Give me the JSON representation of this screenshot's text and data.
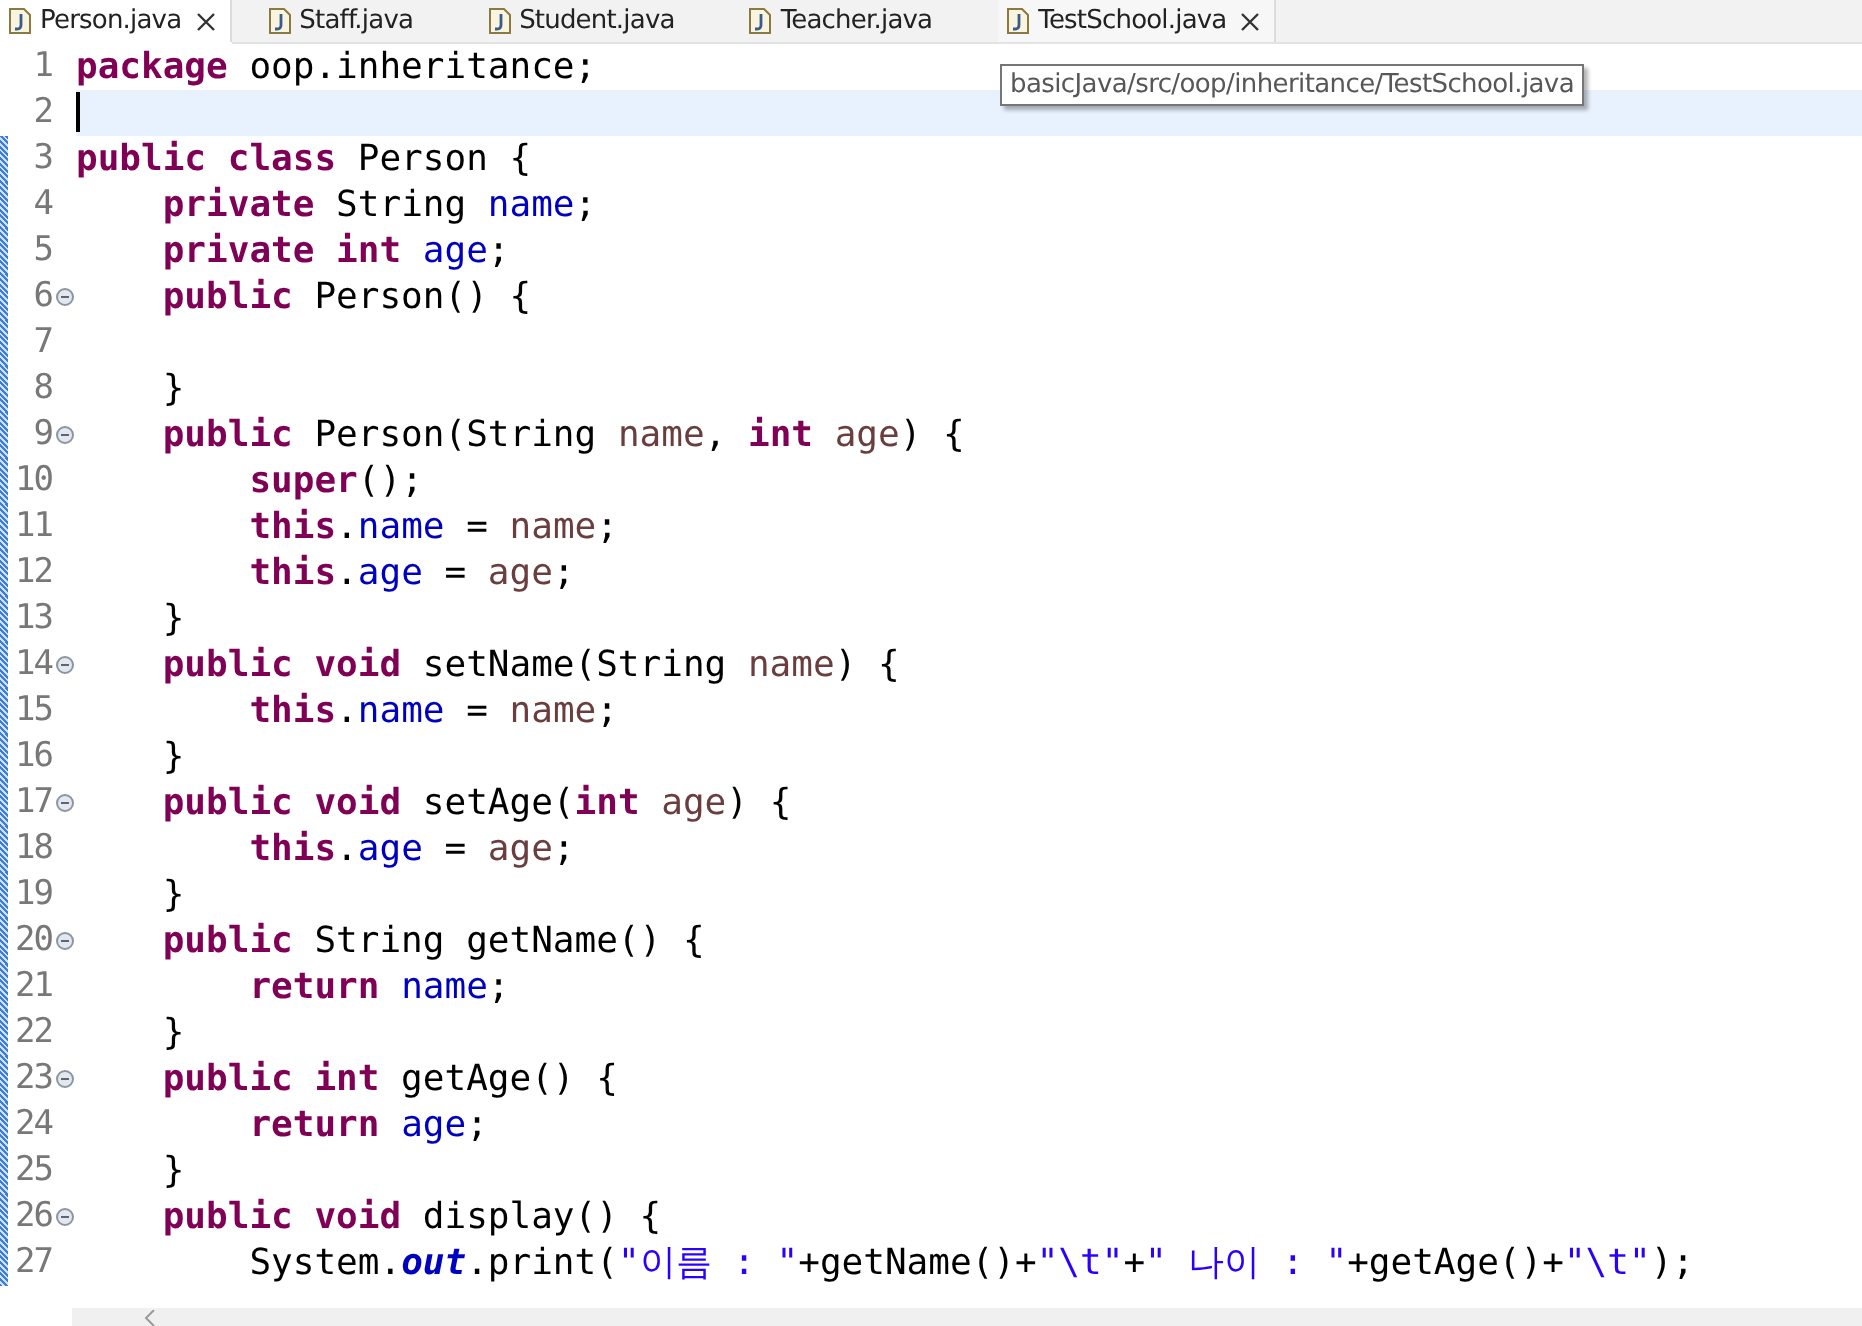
{
  "tabs": [
    {
      "label": "Person.java",
      "selected": true,
      "closable": true
    },
    {
      "label": "Staff.java",
      "selected": false,
      "closable": false
    },
    {
      "label": "Student.java",
      "selected": false,
      "closable": false
    },
    {
      "label": "Teacher.java",
      "selected": false,
      "closable": false
    },
    {
      "label": "TestSchool.java",
      "selected": false,
      "closable": true
    }
  ],
  "tooltip": "basicJava/src/oop/inheritance/TestSchool.java",
  "lines": [
    {
      "number": "1",
      "fold": false,
      "changed": false,
      "current": false,
      "tokens": [
        {
          "kind": "keyword",
          "text": "package"
        },
        {
          "kind": "plain",
          "text": " oop.inheritance;"
        }
      ]
    },
    {
      "number": "2",
      "fold": false,
      "changed": false,
      "current": true
    },
    {
      "number": "3",
      "fold": false,
      "changed": true,
      "current": false,
      "tokens": [
        {
          "kind": "keyword",
          "text": "public class"
        },
        {
          "kind": "plain",
          "text": " Person {"
        }
      ]
    },
    {
      "number": "4",
      "fold": false,
      "changed": true,
      "current": false,
      "tokens": [
        {
          "kind": "keyword",
          "text": "    private"
        },
        {
          "kind": "plain",
          "text": " String "
        },
        {
          "kind": "field",
          "text": "name"
        },
        {
          "kind": "plain",
          "text": ";"
        }
      ]
    },
    {
      "number": "5",
      "fold": false,
      "changed": true,
      "current": false,
      "tokens": [
        {
          "kind": "keyword",
          "text": "    private int "
        },
        {
          "kind": "field",
          "text": "age"
        },
        {
          "kind": "plain",
          "text": ";"
        }
      ]
    },
    {
      "number": "6",
      "fold": true,
      "changed": true,
      "current": false,
      "tokens": [
        {
          "kind": "keyword",
          "text": "    public"
        },
        {
          "kind": "plain",
          "text": " Person() {"
        }
      ]
    },
    {
      "number": "7",
      "fold": false,
      "changed": true,
      "current": false
    },
    {
      "number": "8",
      "fold": false,
      "changed": true,
      "current": false,
      "tokens": [
        {
          "kind": "plain",
          "text": "    }"
        }
      ]
    },
    {
      "number": "9",
      "fold": true,
      "changed": true,
      "current": false,
      "tokens": [
        {
          "kind": "keyword",
          "text": "    public"
        },
        {
          "kind": "plain",
          "text": " Person(String "
        },
        {
          "kind": "param",
          "text": "name"
        },
        {
          "kind": "plain",
          "text": ", "
        },
        {
          "kind": "keyword",
          "text": "int "
        },
        {
          "kind": "param",
          "text": "age"
        },
        {
          "kind": "plain",
          "text": ") {"
        }
      ]
    },
    {
      "number": "10",
      "fold": false,
      "changed": true,
      "current": false,
      "tokens": [
        {
          "kind": "keyword",
          "text": "        super"
        },
        {
          "kind": "plain",
          "text": "();"
        }
      ]
    },
    {
      "number": "11",
      "fold": false,
      "changed": true,
      "current": false,
      "tokens": [
        {
          "kind": "keyword",
          "text": "        this"
        },
        {
          "kind": "plain",
          "text": "."
        },
        {
          "kind": "field",
          "text": "name"
        },
        {
          "kind": "plain",
          "text": " = "
        },
        {
          "kind": "param",
          "text": "name"
        },
        {
          "kind": "plain",
          "text": ";"
        }
      ]
    },
    {
      "number": "12",
      "fold": false,
      "changed": true,
      "current": false,
      "tokens": [
        {
          "kind": "keyword",
          "text": "        this"
        },
        {
          "kind": "plain",
          "text": "."
        },
        {
          "kind": "field",
          "text": "age"
        },
        {
          "kind": "plain",
          "text": " = "
        },
        {
          "kind": "param",
          "text": "age"
        },
        {
          "kind": "plain",
          "text": ";"
        }
      ]
    },
    {
      "number": "13",
      "fold": false,
      "changed": true,
      "current": false,
      "tokens": [
        {
          "kind": "plain",
          "text": "    }"
        }
      ]
    },
    {
      "number": "14",
      "fold": true,
      "changed": true,
      "current": false,
      "tokens": [
        {
          "kind": "keyword",
          "text": "    public void"
        },
        {
          "kind": "plain",
          "text": " setName(String "
        },
        {
          "kind": "param",
          "text": "name"
        },
        {
          "kind": "plain",
          "text": ") {"
        }
      ]
    },
    {
      "number": "15",
      "fold": false,
      "changed": true,
      "current": false,
      "tokens": [
        {
          "kind": "keyword",
          "text": "        this"
        },
        {
          "kind": "plain",
          "text": "."
        },
        {
          "kind": "field",
          "text": "name"
        },
        {
          "kind": "plain",
          "text": " = "
        },
        {
          "kind": "param",
          "text": "name"
        },
        {
          "kind": "plain",
          "text": ";"
        }
      ]
    },
    {
      "number": "16",
      "fold": false,
      "changed": true,
      "current": false,
      "tokens": [
        {
          "kind": "plain",
          "text": "    }"
        }
      ]
    },
    {
      "number": "17",
      "fold": true,
      "changed": true,
      "current": false,
      "tokens": [
        {
          "kind": "keyword",
          "text": "    public void"
        },
        {
          "kind": "plain",
          "text": " setAge("
        },
        {
          "kind": "keyword",
          "text": "int "
        },
        {
          "kind": "param",
          "text": "age"
        },
        {
          "kind": "plain",
          "text": ") {"
        }
      ]
    },
    {
      "number": "18",
      "fold": false,
      "changed": true,
      "current": false,
      "tokens": [
        {
          "kind": "keyword",
          "text": "        this"
        },
        {
          "kind": "plain",
          "text": "."
        },
        {
          "kind": "field",
          "text": "age"
        },
        {
          "kind": "plain",
          "text": " = "
        },
        {
          "kind": "param",
          "text": "age"
        },
        {
          "kind": "plain",
          "text": ";"
        }
      ]
    },
    {
      "number": "19",
      "fold": false,
      "changed": true,
      "current": false,
      "tokens": [
        {
          "kind": "plain",
          "text": "    }"
        }
      ]
    },
    {
      "number": "20",
      "fold": true,
      "changed": true,
      "current": false,
      "tokens": [
        {
          "kind": "keyword",
          "text": "    public"
        },
        {
          "kind": "plain",
          "text": " String getName() {"
        }
      ]
    },
    {
      "number": "21",
      "fold": false,
      "changed": true,
      "current": false,
      "tokens": [
        {
          "kind": "keyword",
          "text": "        return "
        },
        {
          "kind": "field",
          "text": "name"
        },
        {
          "kind": "plain",
          "text": ";"
        }
      ]
    },
    {
      "number": "22",
      "fold": false,
      "changed": true,
      "current": false,
      "tokens": [
        {
          "kind": "plain",
          "text": "    }"
        }
      ]
    },
    {
      "number": "23",
      "fold": true,
      "changed": true,
      "current": false,
      "tokens": [
        {
          "kind": "keyword",
          "text": "    public int"
        },
        {
          "kind": "plain",
          "text": " getAge() {"
        }
      ]
    },
    {
      "number": "24",
      "fold": false,
      "changed": true,
      "current": false,
      "tokens": [
        {
          "kind": "keyword",
          "text": "        return "
        },
        {
          "kind": "field",
          "text": "age"
        },
        {
          "kind": "plain",
          "text": ";"
        }
      ]
    },
    {
      "number": "25",
      "fold": false,
      "changed": true,
      "current": false,
      "tokens": [
        {
          "kind": "plain",
          "text": "    }"
        }
      ]
    },
    {
      "number": "26",
      "fold": true,
      "changed": true,
      "current": false,
      "tokens": [
        {
          "kind": "keyword",
          "text": "    public void"
        },
        {
          "kind": "plain",
          "text": " display() {"
        }
      ]
    },
    {
      "number": "27",
      "fold": false,
      "changed": true,
      "current": false,
      "tokens": [
        {
          "kind": "plain",
          "text": "        System."
        },
        {
          "kind": "static",
          "text": "out"
        },
        {
          "kind": "plain",
          "text": ".print("
        },
        {
          "kind": "string",
          "text": "\"이름 : \""
        },
        {
          "kind": "plain",
          "text": "+getName()+"
        },
        {
          "kind": "string",
          "text": "\"\\t\""
        },
        {
          "kind": "plain",
          "text": "+"
        },
        {
          "kind": "string",
          "text": "\" 나이 : \""
        },
        {
          "kind": "plain",
          "text": "+getAge()+"
        },
        {
          "kind": "string",
          "text": "\"\\t\""
        },
        {
          "kind": "plain",
          "text": ");"
        }
      ]
    }
  ]
}
